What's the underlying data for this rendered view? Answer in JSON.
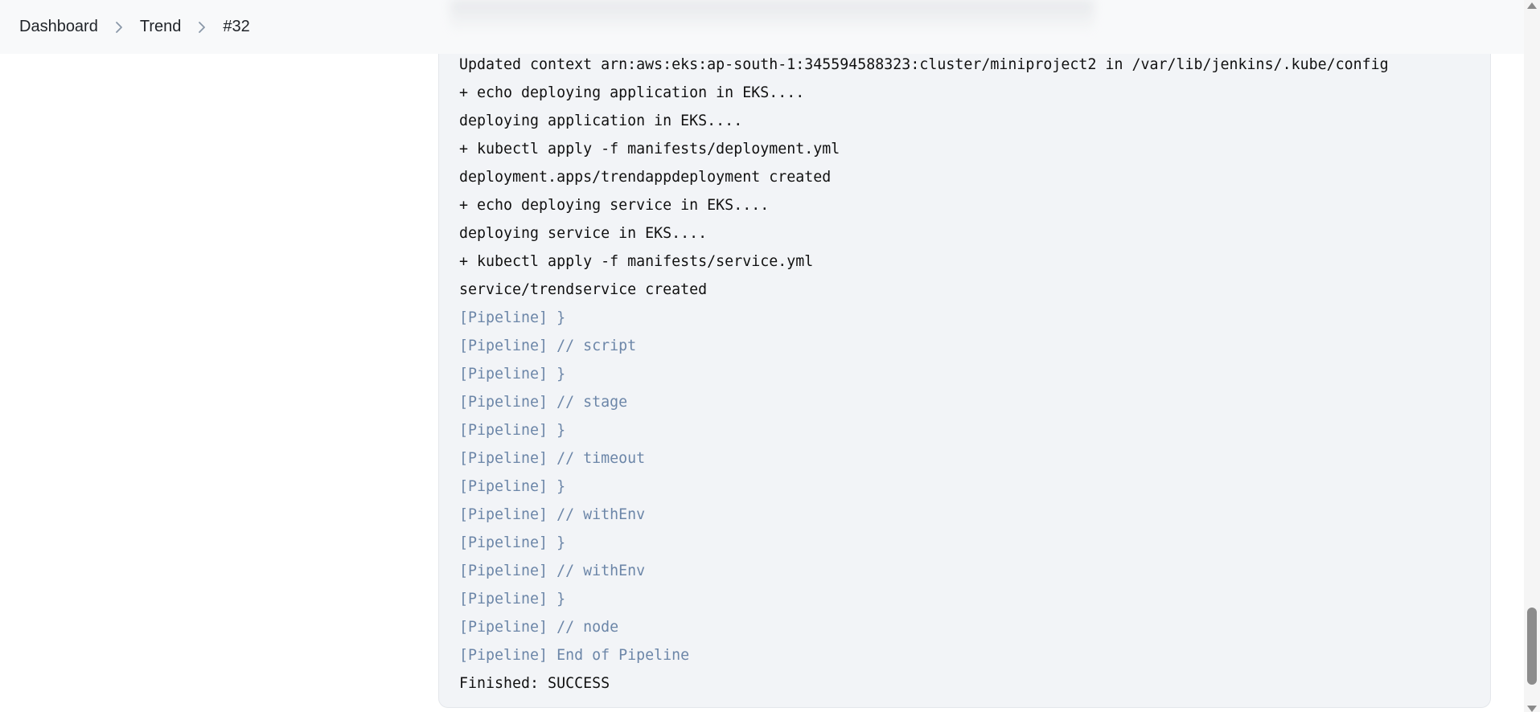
{
  "breadcrumb": {
    "items": [
      "Dashboard",
      "Trend",
      "#32"
    ]
  },
  "console": {
    "lines": [
      {
        "text": "Updated context arn:aws:eks:ap-south-1:345594588323:cluster/miniproject2 in /var/lib/jenkins/.kube/config",
        "pipeline": false
      },
      {
        "text": "+ echo deploying application in EKS....",
        "pipeline": false
      },
      {
        "text": "deploying application in EKS....",
        "pipeline": false
      },
      {
        "text": "+ kubectl apply -f manifests/deployment.yml",
        "pipeline": false
      },
      {
        "text": "deployment.apps/trendappdeployment created",
        "pipeline": false
      },
      {
        "text": "+ echo deploying service in EKS....",
        "pipeline": false
      },
      {
        "text": "deploying service in EKS....",
        "pipeline": false
      },
      {
        "text": "+ kubectl apply -f manifests/service.yml",
        "pipeline": false
      },
      {
        "text": "service/trendservice created",
        "pipeline": false
      },
      {
        "text": "[Pipeline] }",
        "pipeline": true
      },
      {
        "text": "[Pipeline] // script",
        "pipeline": true
      },
      {
        "text": "[Pipeline] }",
        "pipeline": true
      },
      {
        "text": "[Pipeline] // stage",
        "pipeline": true
      },
      {
        "text": "[Pipeline] }",
        "pipeline": true
      },
      {
        "text": "[Pipeline] // timeout",
        "pipeline": true
      },
      {
        "text": "[Pipeline] }",
        "pipeline": true
      },
      {
        "text": "[Pipeline] // withEnv",
        "pipeline": true
      },
      {
        "text": "[Pipeline] }",
        "pipeline": true
      },
      {
        "text": "[Pipeline] // withEnv",
        "pipeline": true
      },
      {
        "text": "[Pipeline] }",
        "pipeline": true
      },
      {
        "text": "[Pipeline] // node",
        "pipeline": true
      },
      {
        "text": "[Pipeline] End of Pipeline",
        "pipeline": true
      },
      {
        "text": "Finished: SUCCESS",
        "pipeline": false
      }
    ]
  },
  "icons": {
    "breadcrumb_separator": "chevron-right-icon"
  },
  "colors": {
    "pipeline_text": "#6c86a8",
    "console_background": "#f2f4f7"
  }
}
